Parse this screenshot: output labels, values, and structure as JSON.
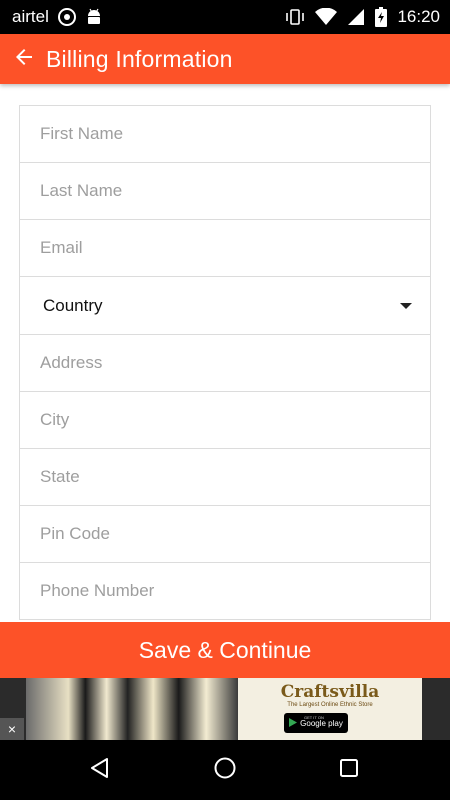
{
  "status_bar": {
    "carrier": "airtel",
    "time": "16:20",
    "icons": [
      "music-icon",
      "android-icon",
      "vibrate-icon",
      "wifi-icon",
      "signal-icon",
      "battery-charging-icon"
    ]
  },
  "app_bar": {
    "title": "Billing Information",
    "back_icon": "arrow-left-icon",
    "background": "#fd5228"
  },
  "form": {
    "first_name": {
      "placeholder": "First Name",
      "value": ""
    },
    "last_name": {
      "placeholder": "Last Name",
      "value": ""
    },
    "email": {
      "placeholder": "Email",
      "value": ""
    },
    "country": {
      "selected": "Country"
    },
    "address": {
      "placeholder": "Address",
      "value": ""
    },
    "city": {
      "placeholder": "City",
      "value": ""
    },
    "state": {
      "placeholder": "State",
      "value": ""
    },
    "pin_code": {
      "placeholder": "Pin Code",
      "value": ""
    },
    "phone_number": {
      "placeholder": "Phone Number",
      "value": ""
    }
  },
  "actions": {
    "save_label": "Save & Continue",
    "accent": "#fd5228"
  },
  "ad": {
    "brand": "Craftsvilla",
    "tagline": "The Largest Online Ethnic Store",
    "badge_top": "GET IT ON",
    "badge": "Google play",
    "close_label": "×"
  },
  "nav_bar": {
    "icons": [
      "back-triangle-icon",
      "home-circle-icon",
      "recents-square-icon"
    ]
  }
}
